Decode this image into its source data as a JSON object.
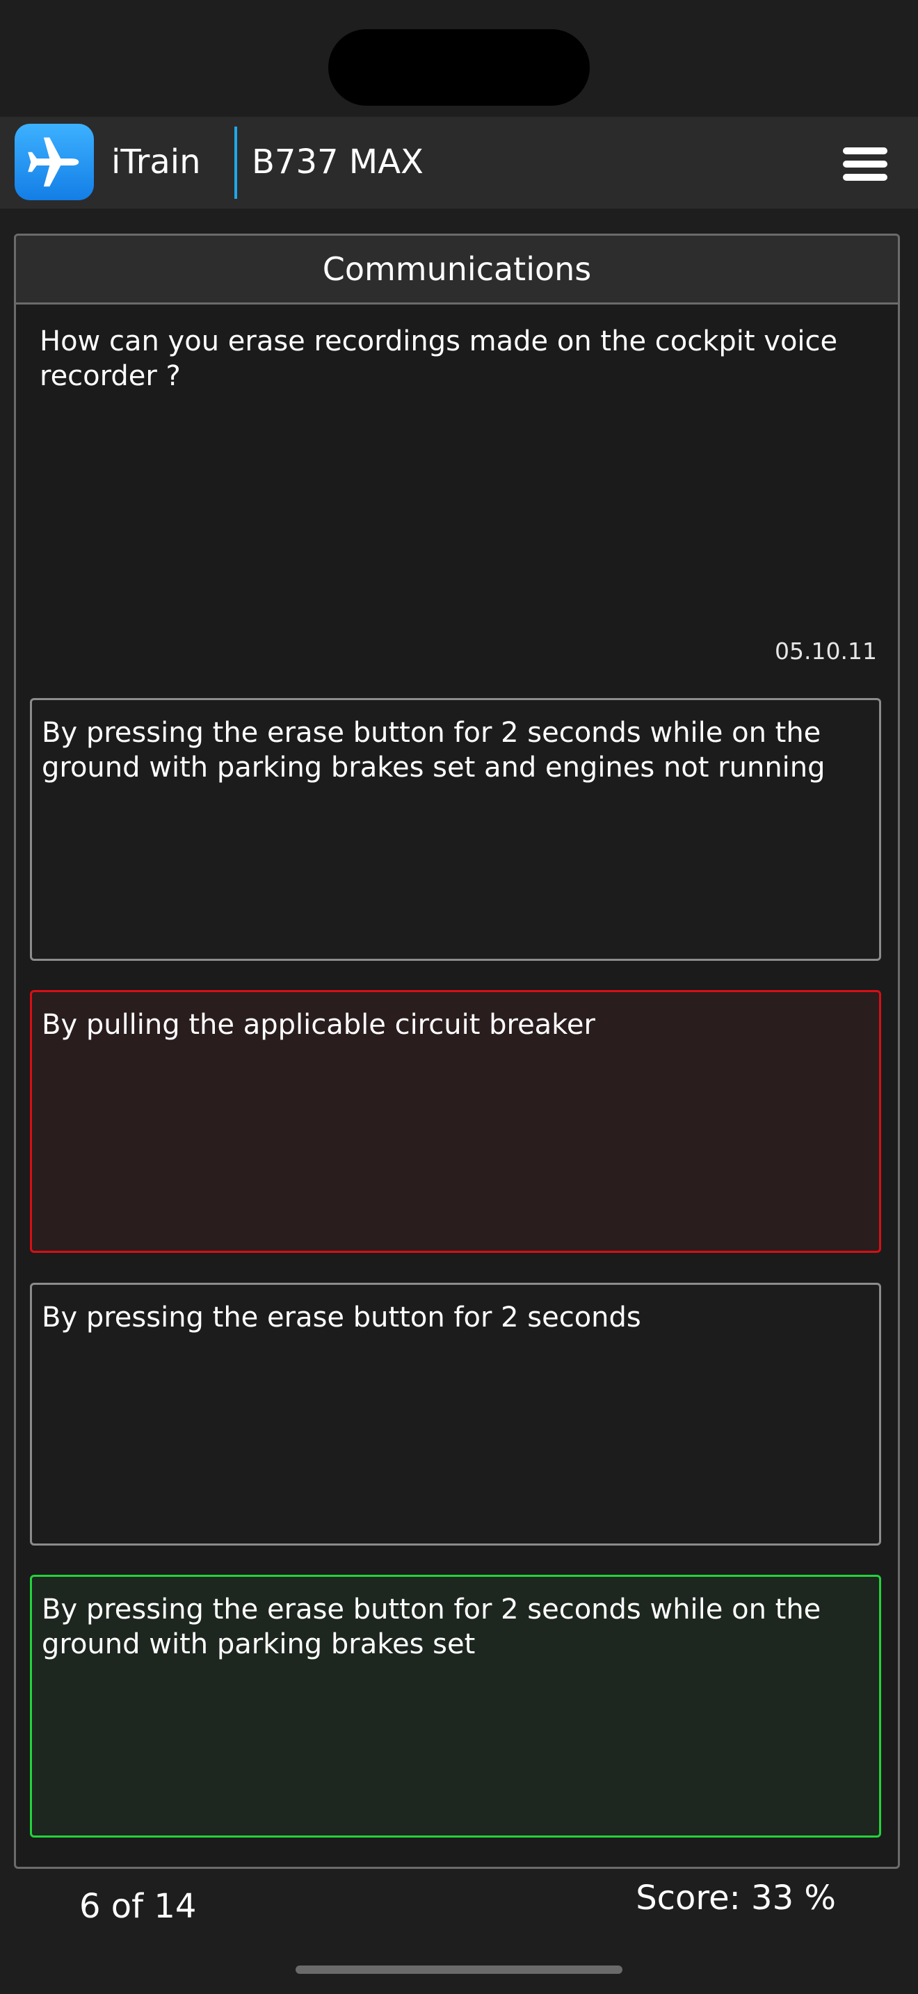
{
  "header": {
    "app_name": "iTrain",
    "aircraft": "B737 MAX",
    "app_icon": "airplane-icon",
    "menu_icon": "hamburger-menu-icon"
  },
  "quiz": {
    "category": "Communications",
    "question": "How can you erase recordings made on the cockpit voice recorder ?",
    "reference": "05.10.11",
    "answers": [
      {
        "text": "By pressing the erase button for 2 seconds while on the ground with parking brakes set and engines not running",
        "state": "neutral"
      },
      {
        "text": "By pulling the applicable circuit breaker",
        "state": "wrong"
      },
      {
        "text": "By pressing the erase button for 2 seconds",
        "state": "neutral"
      },
      {
        "text": "By pressing the erase button for 2 seconds while on the ground with parking brakes set",
        "state": "correct"
      }
    ]
  },
  "footer": {
    "progress": "6 of 14",
    "score": "Score: 33 %"
  },
  "colors": {
    "background": "#1e1e1e",
    "accent_divider": "#1ea7e8",
    "wrong_border": "#d80f14",
    "correct_border": "#22d33a"
  }
}
